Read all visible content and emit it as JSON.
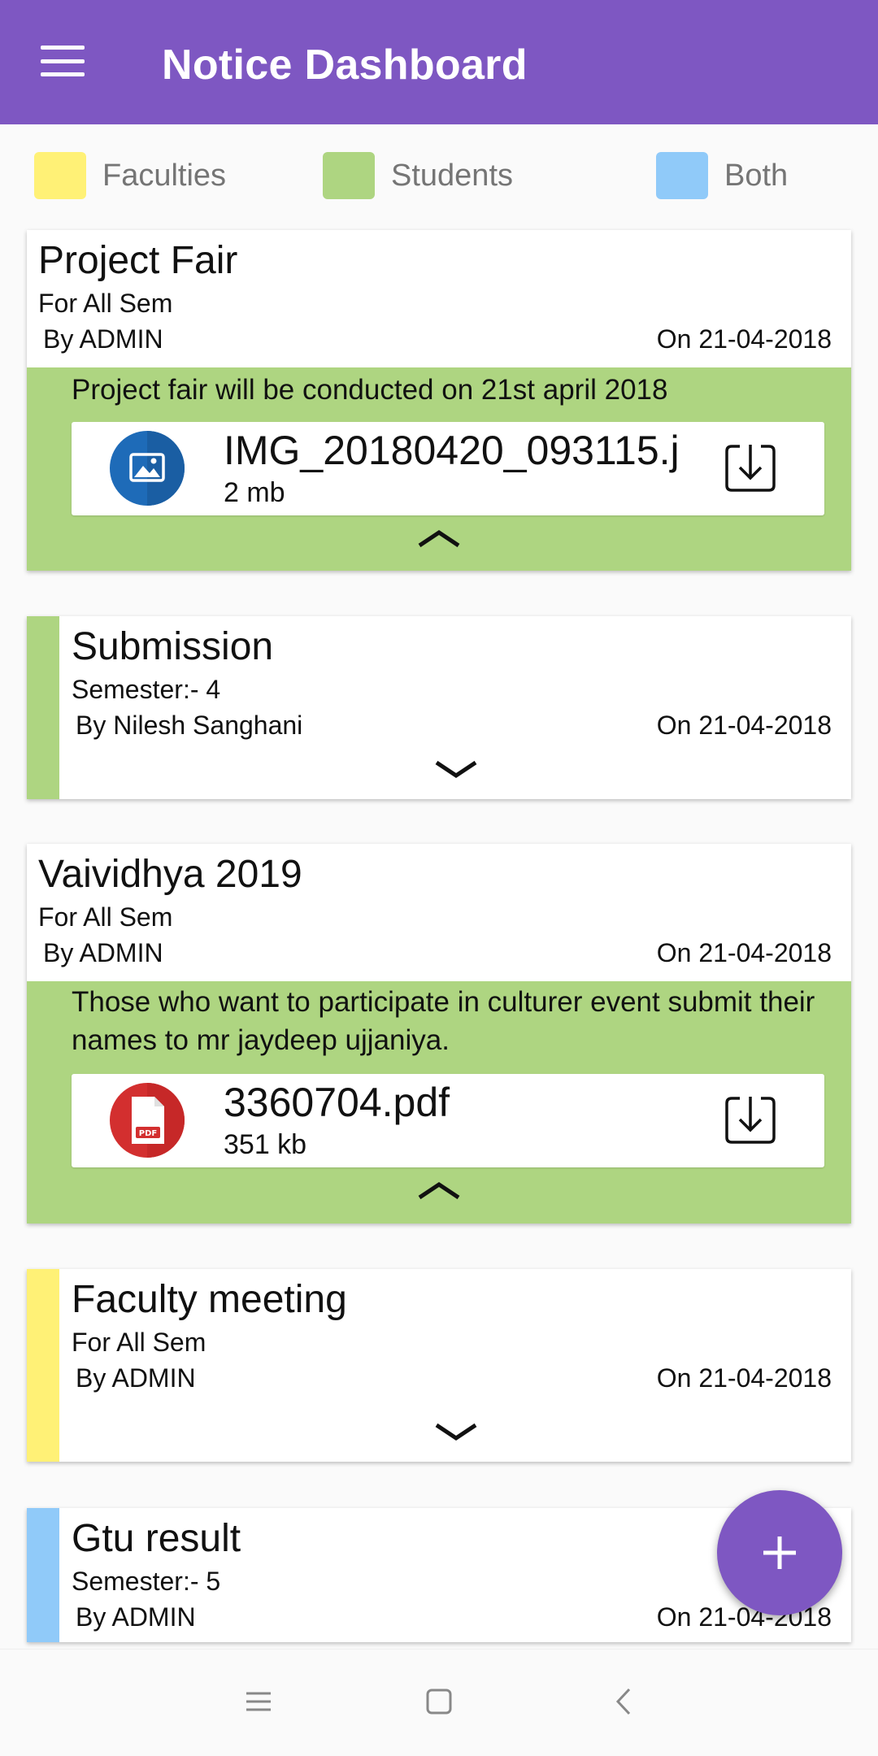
{
  "app": {
    "title": "Notice Dashboard"
  },
  "legend": [
    {
      "label": "Faculties",
      "color": "#fff176"
    },
    {
      "label": "Students",
      "color": "#aed581"
    },
    {
      "label": "Both",
      "color": "#90caf9"
    }
  ],
  "notices": [
    {
      "title": "Project Fair",
      "semester": "For All Sem",
      "author": "By ADMIN",
      "date": "On 21-04-2018",
      "expanded": true,
      "color": "#aed581",
      "description": "Project fair will be conducted on 21st april 2018",
      "attachment": {
        "name": "IMG_20180420_093115.j",
        "size": "2 mb",
        "icon": "image-file-icon"
      }
    },
    {
      "title": "Submission",
      "semester": "Semester:- 4",
      "author": "By Nilesh Sanghani",
      "date": "On 21-04-2018",
      "expanded": false,
      "color": "#aed581"
    },
    {
      "title": "Vaividhya 2019",
      "semester": "For All Sem",
      "author": "By ADMIN",
      "date": "On 21-04-2018",
      "expanded": true,
      "color": "#aed581",
      "description": "Those who want to participate in culturer event submit their names to mr jaydeep ujjaniya.",
      "attachment": {
        "name": "3360704.pdf",
        "size": "351 kb",
        "icon": "pdf-file-icon",
        "icon_label": "PDF"
      }
    },
    {
      "title": "Faculty meeting",
      "semester": "For All Sem",
      "author": "By ADMIN",
      "date": "On 21-04-2018",
      "expanded": false,
      "color": "#fff176"
    },
    {
      "title": "Gtu result",
      "semester": "Semester:- 5",
      "author": "By ADMIN",
      "date": "On 21-04-2018",
      "expanded": false,
      "color": "#90caf9"
    }
  ],
  "colors": {
    "primary": "#7e57c2",
    "students": "#aed581",
    "faculties": "#fff176",
    "both": "#90caf9"
  }
}
